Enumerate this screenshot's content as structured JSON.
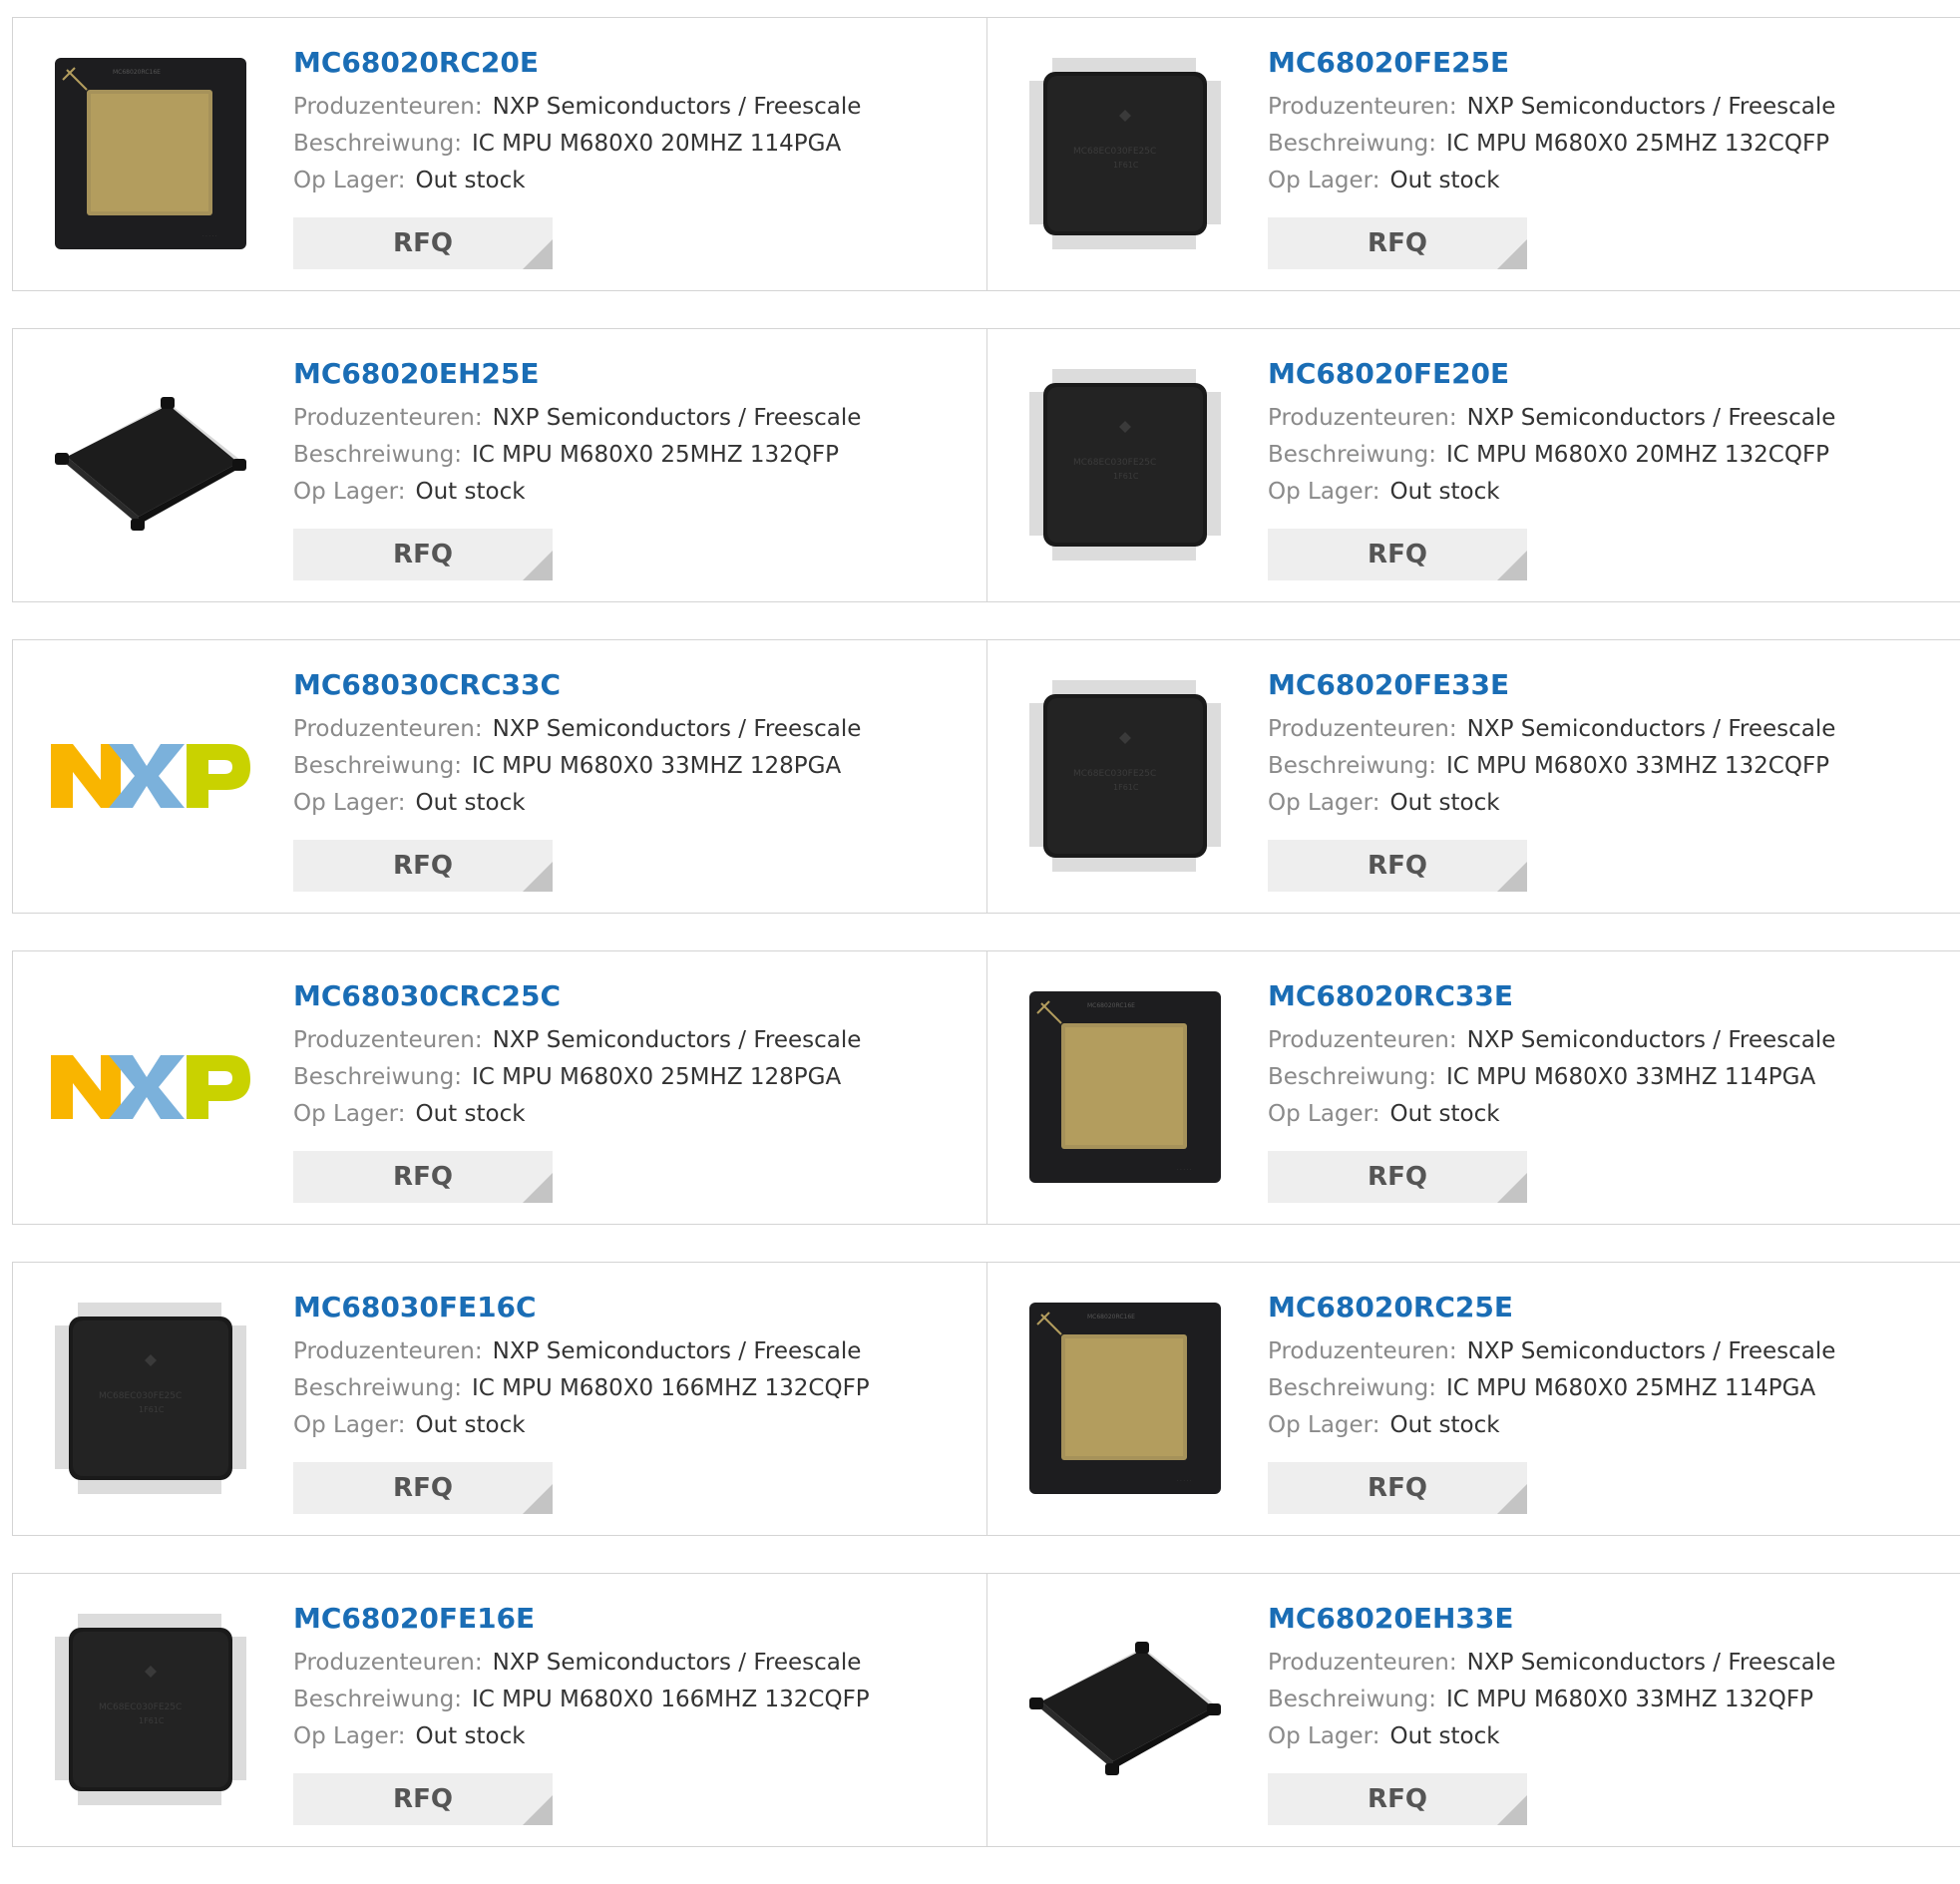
{
  "labels": {
    "manufacturer": "Produzenteuren:",
    "description": "Beschreiwung:",
    "stock": "Op Lager:",
    "rfq": "RFQ"
  },
  "products": [
    {
      "pn": "MC68020RC20E",
      "manufacturer": "NXP Semiconductors / Freescale",
      "description": "IC MPU M680X0 20MHZ 114PGA",
      "stock": "Out stock",
      "image": "pga-chip-icon"
    },
    {
      "pn": "MC68020FE25E",
      "manufacturer": "NXP Semiconductors / Freescale",
      "description": "IC MPU M680X0 25MHZ 132CQFP",
      "stock": "Out stock",
      "image": "cqfp-chip-icon"
    },
    {
      "pn": "MC68020EH25E",
      "manufacturer": "NXP Semiconductors / Freescale",
      "description": "IC MPU M680X0 25MHZ 132QFP",
      "stock": "Out stock",
      "image": "qfp-chip-angled-icon"
    },
    {
      "pn": "MC68020FE20E",
      "manufacturer": "NXP Semiconductors / Freescale",
      "description": "IC MPU M680X0 20MHZ 132CQFP",
      "stock": "Out stock",
      "image": "cqfp-chip-icon"
    },
    {
      "pn": "MC68030CRC33C",
      "manufacturer": "NXP Semiconductors / Freescale",
      "description": "IC MPU M680X0 33MHZ 128PGA",
      "stock": "Out stock",
      "image": "nxp-logo"
    },
    {
      "pn": "MC68020FE33E",
      "manufacturer": "NXP Semiconductors / Freescale",
      "description": "IC MPU M680X0 33MHZ 132CQFP",
      "stock": "Out stock",
      "image": "cqfp-chip-icon"
    },
    {
      "pn": "MC68030CRC25C",
      "manufacturer": "NXP Semiconductors / Freescale",
      "description": "IC MPU M680X0 25MHZ 128PGA",
      "stock": "Out stock",
      "image": "nxp-logo"
    },
    {
      "pn": "MC68020RC33E",
      "manufacturer": "NXP Semiconductors / Freescale",
      "description": "IC MPU M680X0 33MHZ 114PGA",
      "stock": "Out stock",
      "image": "pga-chip-icon"
    },
    {
      "pn": "MC68030FE16C",
      "manufacturer": "NXP Semiconductors / Freescale",
      "description": "IC MPU M680X0 166MHZ 132CQFP",
      "stock": "Out stock",
      "image": "cqfp-chip-icon"
    },
    {
      "pn": "MC68020RC25E",
      "manufacturer": "NXP Semiconductors / Freescale",
      "description": "IC MPU M680X0 25MHZ 114PGA",
      "stock": "Out stock",
      "image": "pga-chip-icon"
    },
    {
      "pn": "MC68020FE16E",
      "manufacturer": "NXP Semiconductors / Freescale",
      "description": "IC MPU M680X0 166MHZ 132CQFP",
      "stock": "Out stock",
      "image": "cqfp-chip-icon"
    },
    {
      "pn": "MC68020EH33E",
      "manufacturer": "NXP Semiconductors / Freescale",
      "description": "IC MPU M680X0 33MHZ 132QFP",
      "stock": "Out stock",
      "image": "qfp-chip-angled-icon"
    }
  ],
  "colors": {
    "link": "#1a6db5",
    "label": "#8a8a8a",
    "value": "#333333",
    "rfq_bg": "#eeeeee",
    "rfq_corner": "#c4c4c4",
    "border": "#d4d4d4",
    "nxp_orange": "#f9b500",
    "nxp_blue": "#7bb1db",
    "nxp_green": "#c9d200"
  }
}
